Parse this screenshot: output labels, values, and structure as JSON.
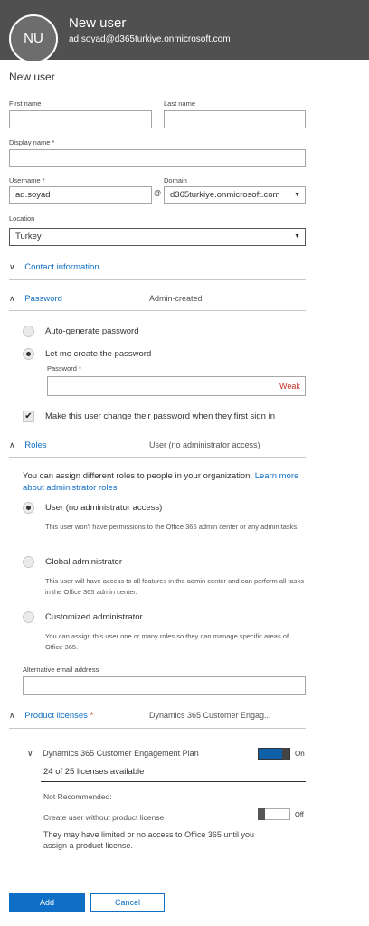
{
  "header": {
    "initials": "NU",
    "title": "New user",
    "email": "ad.soyad@d365turkiye.onmicrosoft.com"
  },
  "form": {
    "title": "New user",
    "first_name": {
      "label": "First name",
      "value": ""
    },
    "last_name": {
      "label": "Last name",
      "value": ""
    },
    "display_name": {
      "label": "Display name *",
      "value": ""
    },
    "username": {
      "label": "Username *",
      "value": "ad.soyad"
    },
    "at_sign": "@",
    "domain": {
      "label": "Domain",
      "value": "d365turkiye.onmicrosoft.com"
    },
    "location": {
      "label": "Location",
      "value": "Turkey"
    }
  },
  "contact": {
    "label": "Contact information"
  },
  "password": {
    "label": "Password",
    "summary": "Admin-created",
    "auto_label": "Auto-generate password",
    "custom_label": "Let me create the password",
    "field_label": "Password *",
    "strength": "Weak",
    "force_change_label": "Make this user change their password when they first sign in"
  },
  "roles": {
    "label": "Roles",
    "summary": "User (no administrator access)",
    "intro": "You can assign different roles to people in your organization.",
    "learn_more": "Learn more about administrator roles",
    "options": [
      {
        "label": "User (no administrator access)",
        "desc": "This user won't have permissions to the Office 365 admin center or any admin tasks."
      },
      {
        "label": "Global administrator",
        "desc": "This user will have access to all features in the admin center and can perform all tasks in the Office 365 admin center."
      },
      {
        "label": "Customized administrator",
        "desc": "You can assign this user one or many roles so they can manage specific areas of Office 365."
      }
    ],
    "alt_email_label": "Alternative email address",
    "alt_email_value": ""
  },
  "licenses": {
    "label": "Product licenses",
    "required_mark": "*",
    "summary": "Dynamics 365 Customer Engag...",
    "plan_name": "Dynamics 365 Customer Engagement Plan",
    "plan_state": "On",
    "plan_available": "24 of 25 licenses available",
    "not_recommended": "Not Recommended:",
    "no_license_label": "Create user without product license",
    "no_license_state": "Off",
    "no_license_note": "They may have limited or no access to Office 365 until you assign a product license."
  },
  "actions": {
    "add": "Add",
    "cancel": "Cancel"
  },
  "colors": {
    "accent": "#0f6fc6",
    "primary_button": "#0f6fc6",
    "weak": "#c4302b",
    "header": "#505050"
  },
  "icons": {
    "expand": "chevron-down-icon",
    "collapse": "chevron-up-icon",
    "dropdown": "caret-down-icon"
  }
}
